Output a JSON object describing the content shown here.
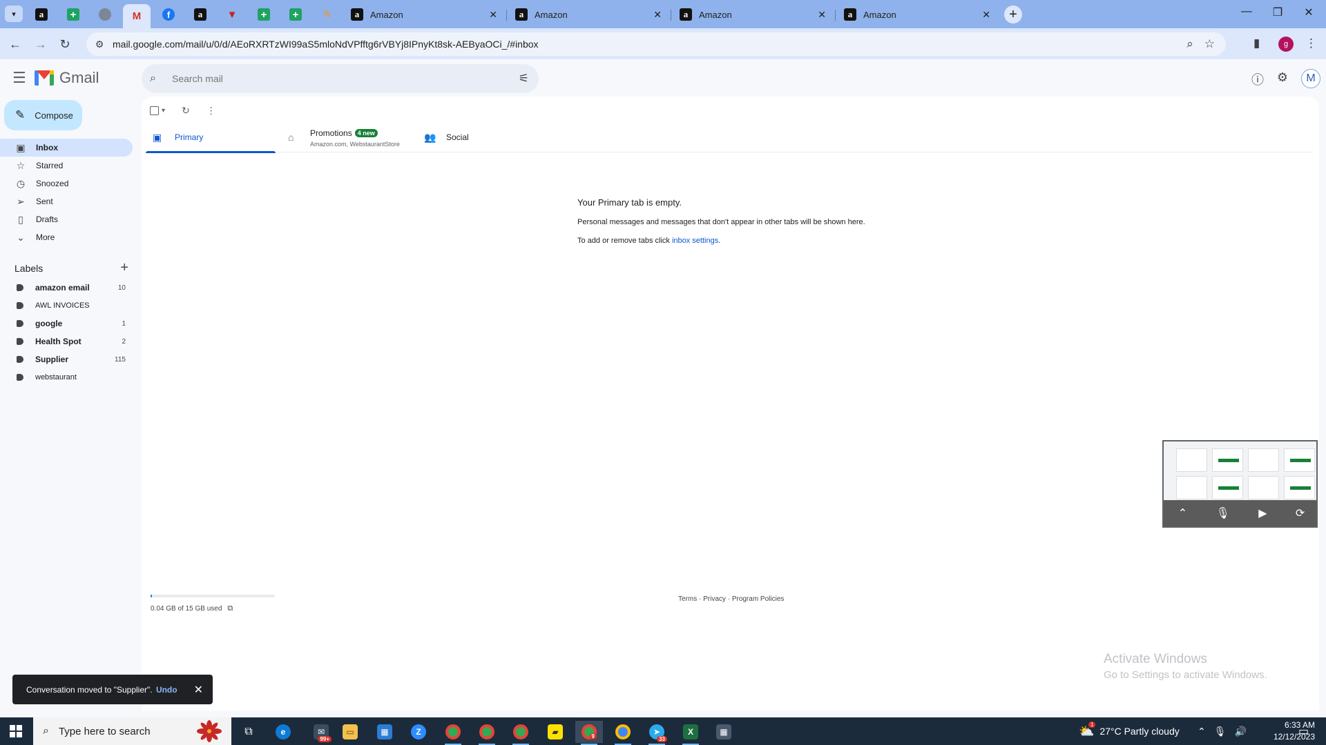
{
  "browser": {
    "tabs": [
      {
        "title": "Amazon",
        "favicon": "amazon-icon"
      },
      {
        "title": "Amazon",
        "favicon": "amazon-icon"
      },
      {
        "title": "Amazon",
        "favicon": "amazon-icon"
      },
      {
        "title": "Amazon",
        "favicon": "amazon-icon"
      }
    ],
    "url": "mail.google.com/mail/u/0/d/AEoRXRTzWI99aS5mloNdVPfftg6rVBYj8IPnyKt8sk-AEByaOCi_/#inbox",
    "profile_initial": "g"
  },
  "gmail": {
    "brand": "Gmail",
    "search_placeholder": "Search mail",
    "avatar_initial": "M",
    "compose_label": "Compose",
    "nav": [
      {
        "label": "Inbox",
        "icon": "inbox-icon",
        "active": true
      },
      {
        "label": "Starred",
        "icon": "star-icon"
      },
      {
        "label": "Snoozed",
        "icon": "clock-icon"
      },
      {
        "label": "Sent",
        "icon": "send-icon"
      },
      {
        "label": "Drafts",
        "icon": "draft-icon"
      },
      {
        "label": "More",
        "icon": "chevron-down-icon"
      }
    ],
    "labels_title": "Labels",
    "labels": [
      {
        "name": "amazon email",
        "count": "10",
        "bold": true
      },
      {
        "name": "AWL INVOICES",
        "count": "",
        "bold": false
      },
      {
        "name": "google",
        "count": "1",
        "bold": true
      },
      {
        "name": "Health Spot",
        "count": "2",
        "bold": true
      },
      {
        "name": "Supplier",
        "count": "115",
        "bold": true
      },
      {
        "name": "webstaurant",
        "count": "",
        "bold": false
      }
    ],
    "categories": {
      "primary": "Primary",
      "promotions": "Promotions",
      "promotions_badge": "4 new",
      "promotions_sub": "Amazon.com, WebstaurantStore",
      "social": "Social"
    },
    "empty_state": {
      "title": "Your Primary tab is empty.",
      "line1": "Personal messages and messages that don't appear in other tabs will be shown here.",
      "line2_prefix": "To add or remove tabs click ",
      "line2_link": "inbox settings",
      "line2_suffix": "."
    },
    "storage": {
      "text": "0.04 GB of 15 GB used",
      "fraction": 0.003
    },
    "footer": {
      "terms": "Terms",
      "privacy": "Privacy",
      "policies": "Program Policies",
      "sep": " · "
    },
    "toast": {
      "message": "Conversation moved to \"Supplier\".",
      "undo": "Undo"
    }
  },
  "watermark": {
    "line1": "Activate Windows",
    "line2": "Go to Settings to activate Windows."
  },
  "taskbar": {
    "search_placeholder": "Type here to search",
    "mail_badge": "99+",
    "chrome_badge": "9",
    "telegram_badge": "33",
    "weather_badge": "1",
    "weather": "27°C  Partly cloudy",
    "time": "6:33 AM",
    "date": "12/12/2023"
  }
}
